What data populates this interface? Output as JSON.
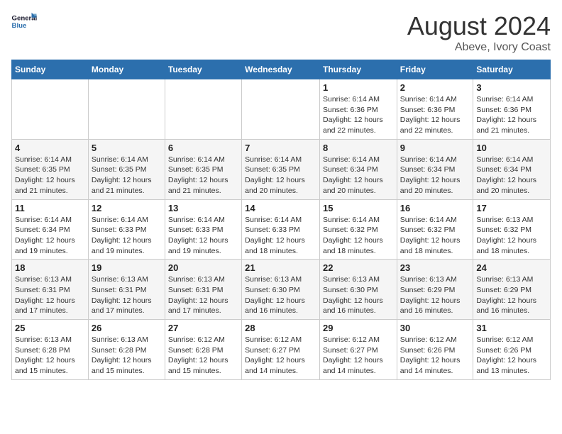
{
  "header": {
    "logo_general": "General",
    "logo_blue": "Blue",
    "month_year": "August 2024",
    "location": "Abeve, Ivory Coast"
  },
  "days_of_week": [
    "Sunday",
    "Monday",
    "Tuesday",
    "Wednesday",
    "Thursday",
    "Friday",
    "Saturday"
  ],
  "weeks": [
    [
      {
        "num": "",
        "info": ""
      },
      {
        "num": "",
        "info": ""
      },
      {
        "num": "",
        "info": ""
      },
      {
        "num": "",
        "info": ""
      },
      {
        "num": "1",
        "info": "Sunrise: 6:14 AM\nSunset: 6:36 PM\nDaylight: 12 hours\nand 22 minutes."
      },
      {
        "num": "2",
        "info": "Sunrise: 6:14 AM\nSunset: 6:36 PM\nDaylight: 12 hours\nand 22 minutes."
      },
      {
        "num": "3",
        "info": "Sunrise: 6:14 AM\nSunset: 6:36 PM\nDaylight: 12 hours\nand 21 minutes."
      }
    ],
    [
      {
        "num": "4",
        "info": "Sunrise: 6:14 AM\nSunset: 6:35 PM\nDaylight: 12 hours\nand 21 minutes."
      },
      {
        "num": "5",
        "info": "Sunrise: 6:14 AM\nSunset: 6:35 PM\nDaylight: 12 hours\nand 21 minutes."
      },
      {
        "num": "6",
        "info": "Sunrise: 6:14 AM\nSunset: 6:35 PM\nDaylight: 12 hours\nand 21 minutes."
      },
      {
        "num": "7",
        "info": "Sunrise: 6:14 AM\nSunset: 6:35 PM\nDaylight: 12 hours\nand 20 minutes."
      },
      {
        "num": "8",
        "info": "Sunrise: 6:14 AM\nSunset: 6:34 PM\nDaylight: 12 hours\nand 20 minutes."
      },
      {
        "num": "9",
        "info": "Sunrise: 6:14 AM\nSunset: 6:34 PM\nDaylight: 12 hours\nand 20 minutes."
      },
      {
        "num": "10",
        "info": "Sunrise: 6:14 AM\nSunset: 6:34 PM\nDaylight: 12 hours\nand 20 minutes."
      }
    ],
    [
      {
        "num": "11",
        "info": "Sunrise: 6:14 AM\nSunset: 6:34 PM\nDaylight: 12 hours\nand 19 minutes."
      },
      {
        "num": "12",
        "info": "Sunrise: 6:14 AM\nSunset: 6:33 PM\nDaylight: 12 hours\nand 19 minutes."
      },
      {
        "num": "13",
        "info": "Sunrise: 6:14 AM\nSunset: 6:33 PM\nDaylight: 12 hours\nand 19 minutes."
      },
      {
        "num": "14",
        "info": "Sunrise: 6:14 AM\nSunset: 6:33 PM\nDaylight: 12 hours\nand 18 minutes."
      },
      {
        "num": "15",
        "info": "Sunrise: 6:14 AM\nSunset: 6:32 PM\nDaylight: 12 hours\nand 18 minutes."
      },
      {
        "num": "16",
        "info": "Sunrise: 6:14 AM\nSunset: 6:32 PM\nDaylight: 12 hours\nand 18 minutes."
      },
      {
        "num": "17",
        "info": "Sunrise: 6:13 AM\nSunset: 6:32 PM\nDaylight: 12 hours\nand 18 minutes."
      }
    ],
    [
      {
        "num": "18",
        "info": "Sunrise: 6:13 AM\nSunset: 6:31 PM\nDaylight: 12 hours\nand 17 minutes."
      },
      {
        "num": "19",
        "info": "Sunrise: 6:13 AM\nSunset: 6:31 PM\nDaylight: 12 hours\nand 17 minutes."
      },
      {
        "num": "20",
        "info": "Sunrise: 6:13 AM\nSunset: 6:31 PM\nDaylight: 12 hours\nand 17 minutes."
      },
      {
        "num": "21",
        "info": "Sunrise: 6:13 AM\nSunset: 6:30 PM\nDaylight: 12 hours\nand 16 minutes."
      },
      {
        "num": "22",
        "info": "Sunrise: 6:13 AM\nSunset: 6:30 PM\nDaylight: 12 hours\nand 16 minutes."
      },
      {
        "num": "23",
        "info": "Sunrise: 6:13 AM\nSunset: 6:29 PM\nDaylight: 12 hours\nand 16 minutes."
      },
      {
        "num": "24",
        "info": "Sunrise: 6:13 AM\nSunset: 6:29 PM\nDaylight: 12 hours\nand 16 minutes."
      }
    ],
    [
      {
        "num": "25",
        "info": "Sunrise: 6:13 AM\nSunset: 6:28 PM\nDaylight: 12 hours\nand 15 minutes."
      },
      {
        "num": "26",
        "info": "Sunrise: 6:13 AM\nSunset: 6:28 PM\nDaylight: 12 hours\nand 15 minutes."
      },
      {
        "num": "27",
        "info": "Sunrise: 6:12 AM\nSunset: 6:28 PM\nDaylight: 12 hours\nand 15 minutes."
      },
      {
        "num": "28",
        "info": "Sunrise: 6:12 AM\nSunset: 6:27 PM\nDaylight: 12 hours\nand 14 minutes."
      },
      {
        "num": "29",
        "info": "Sunrise: 6:12 AM\nSunset: 6:27 PM\nDaylight: 12 hours\nand 14 minutes."
      },
      {
        "num": "30",
        "info": "Sunrise: 6:12 AM\nSunset: 6:26 PM\nDaylight: 12 hours\nand 14 minutes."
      },
      {
        "num": "31",
        "info": "Sunrise: 6:12 AM\nSunset: 6:26 PM\nDaylight: 12 hours\nand 13 minutes."
      }
    ]
  ]
}
